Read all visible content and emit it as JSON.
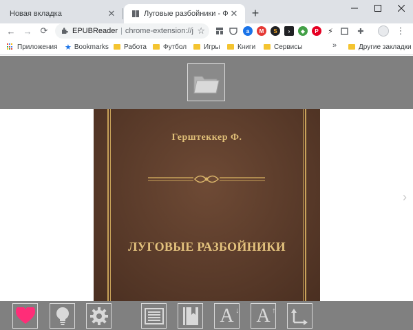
{
  "tabs": [
    {
      "title": "Новая вкладка"
    },
    {
      "title": "Луговые разбойники - Фридрих"
    }
  ],
  "toolbar": {
    "site_name": "EPUBReader",
    "url": "chrome-extension://j..."
  },
  "bookmarks": {
    "items": [
      {
        "label": "Приложения"
      },
      {
        "label": "Bookmarks"
      },
      {
        "label": "Работа"
      },
      {
        "label": "Футбол"
      },
      {
        "label": "Игры"
      },
      {
        "label": "Книги"
      },
      {
        "label": "Сервисы"
      }
    ],
    "more": "»",
    "other": "Другие закладки"
  },
  "book": {
    "author": "Герштеккер Ф.",
    "title": "ЛУГОВЫЕ РАЗБОЙНИКИ"
  },
  "colors": {
    "panel": "#808080",
    "cover": "#5a3b2a",
    "gold": "#e0bf78",
    "heart": "#ff2d78"
  },
  "icons": {
    "open": "folder-icon",
    "favorite": "heart-icon",
    "night_mode": "lightbulb-icon",
    "settings": "gear-icon",
    "toc": "table-of-contents-icon",
    "bookmarks": "book-icon",
    "font_decrease": "font-decrease-icon",
    "font_increase": "font-increase-icon",
    "fullscreen": "expand-arrows-icon"
  }
}
